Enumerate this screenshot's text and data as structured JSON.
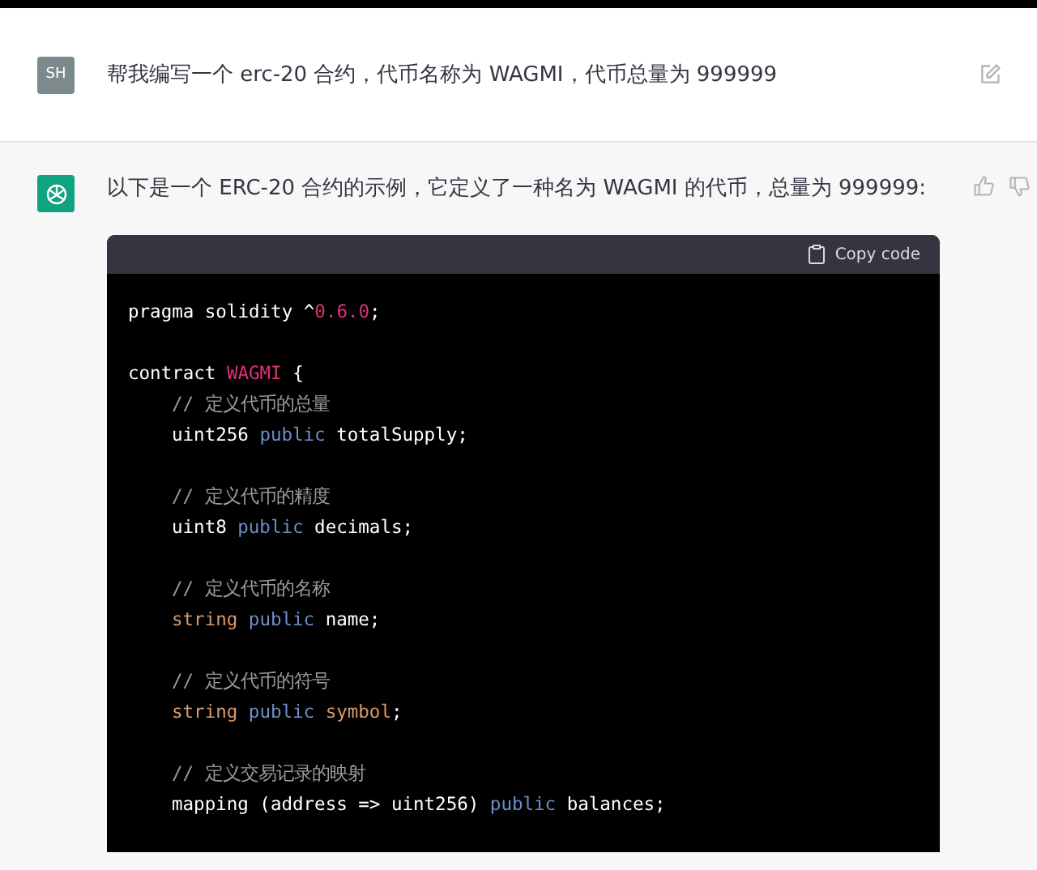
{
  "user_message": {
    "avatar": "SH",
    "text": "帮我编写一个 erc-20 合约，代币名称为  WAGMI，代币总量为 999999"
  },
  "assistant_message": {
    "text": "以下是一个 ERC-20 合约的示例，它定义了一种名为 WAGMI 的代币，总量为 999999:",
    "code": {
      "copy_label": "Copy code",
      "blocks": [
        {
          "lines": [
            [
              {
                "kind": "plain",
                "text": "pragma solidity ^"
              },
              {
                "kind": "number",
                "text": "0.6.0"
              },
              {
                "kind": "plain",
                "text": ";"
              }
            ]
          ]
        },
        {
          "lines": [
            [
              {
                "kind": "plain",
                "text": "contract "
              },
              {
                "kind": "title",
                "text": "WAGMI"
              },
              {
                "kind": "plain",
                "text": " {"
              }
            ]
          ],
          "children": [
            {
              "lines": [
                [
                  {
                    "kind": "comment",
                    "text": "// 定义代币的总量"
                  }
                ],
                [
                  {
                    "kind": "plain",
                    "text": "uint256 "
                  },
                  {
                    "kind": "keyword",
                    "text": "public"
                  },
                  {
                    "kind": "plain",
                    "text": " totalSupply;"
                  }
                ]
              ]
            },
            {
              "lines": [
                [
                  {
                    "kind": "comment",
                    "text": "// 定义代币的精度"
                  }
                ],
                [
                  {
                    "kind": "plain",
                    "text": "uint8 "
                  },
                  {
                    "kind": "keyword",
                    "text": "public"
                  },
                  {
                    "kind": "plain",
                    "text": " decimals;"
                  }
                ]
              ]
            },
            {
              "lines": [
                [
                  {
                    "kind": "comment",
                    "text": "// 定义代币的名称"
                  }
                ],
                [
                  {
                    "kind": "type",
                    "text": "string "
                  },
                  {
                    "kind": "keyword",
                    "text": "public"
                  },
                  {
                    "kind": "plain",
                    "text": " name;"
                  }
                ]
              ]
            },
            {
              "lines": [
                [
                  {
                    "kind": "comment",
                    "text": "// 定义代币的符号"
                  }
                ],
                [
                  {
                    "kind": "type",
                    "text": "string "
                  },
                  {
                    "kind": "keyword",
                    "text": "public "
                  },
                  {
                    "kind": "type",
                    "text": "symbol"
                  },
                  {
                    "kind": "plain",
                    "text": ";"
                  }
                ]
              ]
            },
            {
              "lines": [
                [
                  {
                    "kind": "comment",
                    "text": "// 定义交易记录的映射"
                  }
                ],
                [
                  {
                    "kind": "plain",
                    "text": "mapping (address => uint256) "
                  },
                  {
                    "kind": "keyword",
                    "text": "public"
                  },
                  {
                    "kind": "plain",
                    "text": " balances;"
                  }
                ]
              ]
            }
          ]
        }
      ]
    }
  }
}
